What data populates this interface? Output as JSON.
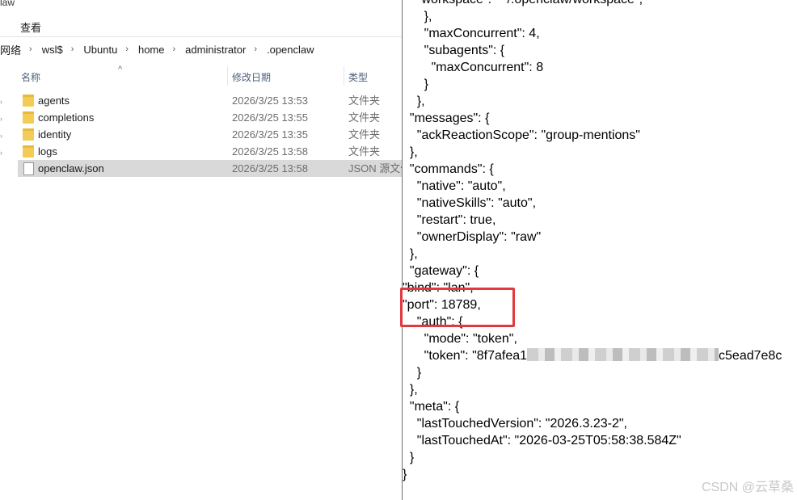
{
  "window": {
    "title_fragment": "law"
  },
  "menu": {
    "view": "查看"
  },
  "address": {
    "crumbs": [
      "网络",
      "wsl$",
      "Ubuntu",
      "home",
      "administrator",
      ".openclaw"
    ]
  },
  "columns": {
    "name": "名称",
    "modified": "修改日期",
    "type": "类型"
  },
  "files": [
    {
      "name": "agents",
      "modified": "2026/3/25 13:53",
      "type": "文件夹",
      "icon": "folder-icon"
    },
    {
      "name": "completions",
      "modified": "2026/3/25 13:55",
      "type": "文件夹",
      "icon": "folder-icon"
    },
    {
      "name": "identity",
      "modified": "2026/3/25 13:35",
      "type": "文件夹",
      "icon": "folder-icon"
    },
    {
      "name": "logs",
      "modified": "2026/3/25 13:58",
      "type": "文件夹",
      "icon": "folder-icon"
    },
    {
      "name": "openclaw.json",
      "modified": "2026/3/25 13:58",
      "type": "JSON 源文件",
      "icon": "json-file-icon",
      "selected": true
    }
  ],
  "editor": {
    "lines": [
      "    \"workspace\": \"~/.openclaw/workspace\",",
      "      },",
      "      \"maxConcurrent\": 4,",
      "      \"subagents\": {",
      "        \"maxConcurrent\": 8",
      "      }",
      "    },",
      "  \"messages\": {",
      "    \"ackReactionScope\": \"group-mentions\"",
      "  },",
      "  \"commands\": {",
      "    \"native\": \"auto\",",
      "    \"nativeSkills\": \"auto\",",
      "    \"restart\": true,",
      "    \"ownerDisplay\": \"raw\"",
      "  },",
      "  \"gateway\": {",
      "\"bind\": \"lan\",",
      "\"port\": 18789,",
      "    \"auth\": {",
      "      \"mode\": \"token\",",
      "      \"token\": \"8f7afea1",
      "    }",
      "  },",
      "  \"meta\": {",
      "    \"lastTouchedVersion\": \"2026.3.23-2\",",
      "    \"lastTouchedAt\": \"2026-03-25T05:58:38.584Z\"",
      "  }",
      "}"
    ],
    "token_suffix": "c5ead7e8c"
  },
  "watermark": "CSDN @云草桑",
  "colors": {
    "highlight": "#e1393e",
    "selected_row": "#d9d9d9",
    "folder": "#f3cc58"
  }
}
